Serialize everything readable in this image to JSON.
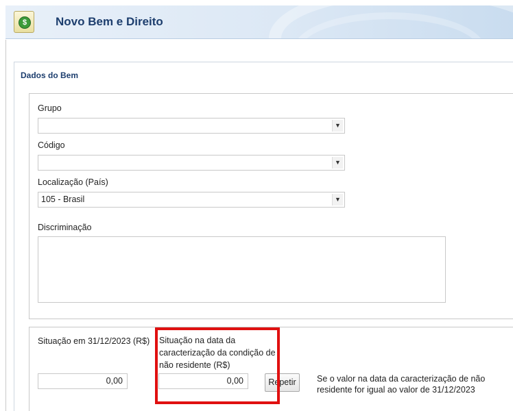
{
  "header": {
    "title": "Novo Bem e Direito",
    "icon": "money-icon"
  },
  "section": {
    "title": "Dados do Bem"
  },
  "fields": {
    "grupo": {
      "label": "Grupo",
      "value": ""
    },
    "codigo": {
      "label": "Código",
      "value": ""
    },
    "localizacao": {
      "label": "Localização (País)",
      "value": "105 - Brasil"
    },
    "discriminacao": {
      "label": "Discriminação",
      "value": ""
    }
  },
  "values": {
    "situacao_anterior": {
      "label": "Situação em 31/12/2023 (R$)",
      "value": "0,00"
    },
    "situacao_nao_residente": {
      "label": "Situação na data da caracterização da condição de não residente (R$)",
      "value": "0,00"
    },
    "repeat_button": "Repetir",
    "repeat_note": "Se o valor na data da caracterização de não residente for igual ao valor de 31/12/2023"
  },
  "highlight_color": "#e01010"
}
